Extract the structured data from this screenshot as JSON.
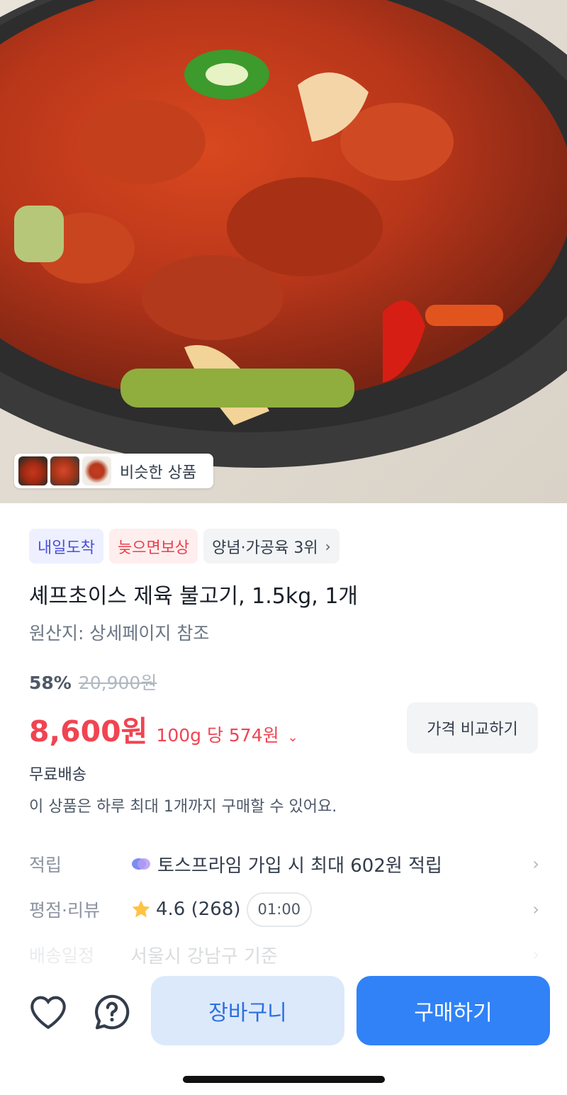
{
  "similar": {
    "label": "비슷한 상품"
  },
  "tags": [
    {
      "label": "내일도착"
    },
    {
      "label": "늦으면보상"
    },
    {
      "label": "양념·가공육 3위"
    }
  ],
  "product": {
    "title": "셰프초이스 제육 불고기, 1.5kg, 1개",
    "origin": "원산지: 상세페이지 참조",
    "discount": "58%",
    "original_price": "20,900원",
    "price": "8,600원",
    "unit_price": "100g 당 574원",
    "compare_label": "가격 비교하기",
    "shipping": "무료배송",
    "limit_notice": "이 상품은 하루 최대 1개까지 구매할 수 있어요."
  },
  "info": {
    "points": {
      "label": "적립",
      "value": "토스프라임 가입 시 최대 602원 적립"
    },
    "rating": {
      "label": "평점·리뷰",
      "value": "4.6 (268)",
      "video_time": "01:00"
    },
    "delivery": {
      "label": "배송일정",
      "value": "서울시 강남구 기준"
    }
  },
  "actions": {
    "cart": "장바구니",
    "buy": "구매하기"
  },
  "colors": {
    "accent": "#3182f6",
    "price": "#f04452",
    "star": "#ffc342"
  }
}
